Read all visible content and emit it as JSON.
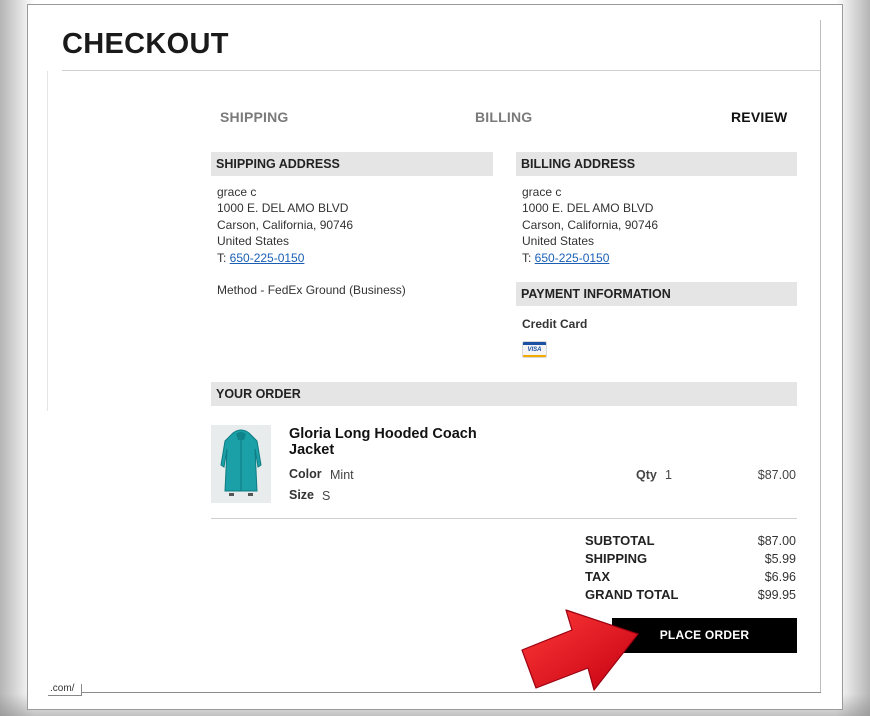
{
  "page_title": "CHECKOUT",
  "steps": [
    {
      "label": "SHIPPING",
      "active": false
    },
    {
      "label": "BILLING",
      "active": false
    },
    {
      "label": "REVIEW",
      "active": true
    }
  ],
  "shipping_address": {
    "heading": "SHIPPING ADDRESS",
    "name": "grace c",
    "street": "1000 E. DEL AMO BLVD",
    "city_line": "Carson, California, 90746",
    "country": "United States",
    "phone_prefix": "T: ",
    "phone": "650-225-0150",
    "method": "Method - FedEx Ground (Business)"
  },
  "billing_address": {
    "heading": "BILLING ADDRESS",
    "name": "grace c",
    "street": "1000 E. DEL AMO BLVD",
    "city_line": "Carson, California, 90746",
    "country": "United States",
    "phone_prefix": "T: ",
    "phone": "650-225-0150"
  },
  "payment": {
    "heading": "PAYMENT INFORMATION",
    "method_label": "Credit Card",
    "card_icon": "visa-card-icon",
    "card_brand_text": "VISA"
  },
  "order": {
    "heading": "YOUR ORDER",
    "item": {
      "name": "Gloria Long Hooded Coach Jacket",
      "color_label": "Color",
      "color_value": "Mint",
      "size_label": "Size",
      "size_value": "S",
      "qty_label": "Qty",
      "qty_value": "1",
      "price": "$87.00",
      "thumbnail_color": "#1aa0a6"
    }
  },
  "totals": [
    {
      "label": "SUBTOTAL",
      "value": "$87.00"
    },
    {
      "label": "SHIPPING",
      "value": "$5.99"
    },
    {
      "label": "TAX",
      "value": "$6.96"
    },
    {
      "label": "GRAND TOTAL",
      "value": "$99.95"
    }
  ],
  "place_order_label": "PLACE ORDER",
  "url_fragment": ".com/",
  "colors": {
    "section_bg": "#e5e5e5",
    "button_bg": "#000000",
    "link": "#1a5fb4",
    "arrow": "#e8141c"
  }
}
